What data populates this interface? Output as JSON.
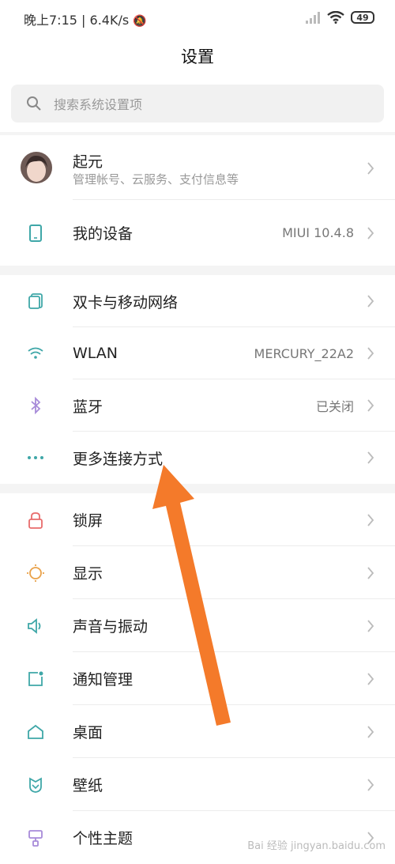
{
  "status": {
    "time": "晚上7:15",
    "speed": "6.4K/s",
    "battery": "49"
  },
  "title": "设置",
  "search": {
    "placeholder": "搜索系统设置项"
  },
  "account": {
    "name": "起元",
    "subtitle": "管理帐号、云服务、支付信息等"
  },
  "device": {
    "label": "我的设备",
    "value": "MIUI 10.4.8"
  },
  "network": [
    {
      "label": "双卡与移动网络",
      "value": "",
      "icon": "sim-icon"
    },
    {
      "label": "WLAN",
      "value": "MERCURY_22A2",
      "icon": "wifi-icon"
    },
    {
      "label": "蓝牙",
      "value": "已关闭",
      "icon": "bluetooth-icon"
    },
    {
      "label": "更多连接方式",
      "value": "",
      "icon": "more-icon"
    }
  ],
  "system": [
    {
      "label": "锁屏",
      "icon": "lock-icon"
    },
    {
      "label": "显示",
      "icon": "brightness-icon"
    },
    {
      "label": "声音与振动",
      "icon": "speaker-icon"
    },
    {
      "label": "通知管理",
      "icon": "notification-icon"
    },
    {
      "label": "桌面",
      "icon": "home-icon"
    },
    {
      "label": "壁纸",
      "icon": "wallpaper-icon"
    },
    {
      "label": "个性主题",
      "icon": "theme-icon"
    }
  ],
  "watermark": "Bai 经验 jingyan.baidu.com",
  "colors": {
    "arrow": "#f47a2a",
    "icon_teal": "#3fa7a8",
    "icon_purple": "#a78bd9",
    "icon_red": "#e86b6b",
    "icon_orange": "#e9a24a"
  }
}
